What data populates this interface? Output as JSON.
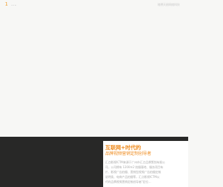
{
  "header": {
    "page_number": "1",
    "page_dots": "...",
    "brand_link": "驰骋天册网络科技"
  },
  "intro_card": {
    "title": "互联网+时代的",
    "subtitle": "品牌视频营销定制创导者",
    "body_lines": [
      "汇点影视ICTM来源于广州市汇点品牌策划有限公",
      "司，公司拥有 1200m2 拍摄基地、服务项目有",
      "片、影视广告拍摄、营销型视频广告拍摄定制",
      "说明类、电商产品拍摄等，汇点影视ICTM以",
      "代的品牌视频营销定制创导者\"定位..."
    ]
  },
  "colors": {
    "accent": "#ee8a1c",
    "page_bg": "#f7f7f5",
    "dark_panel": "#282827",
    "card_bg": "#ffffff",
    "body_text": "#aaaaaa"
  }
}
